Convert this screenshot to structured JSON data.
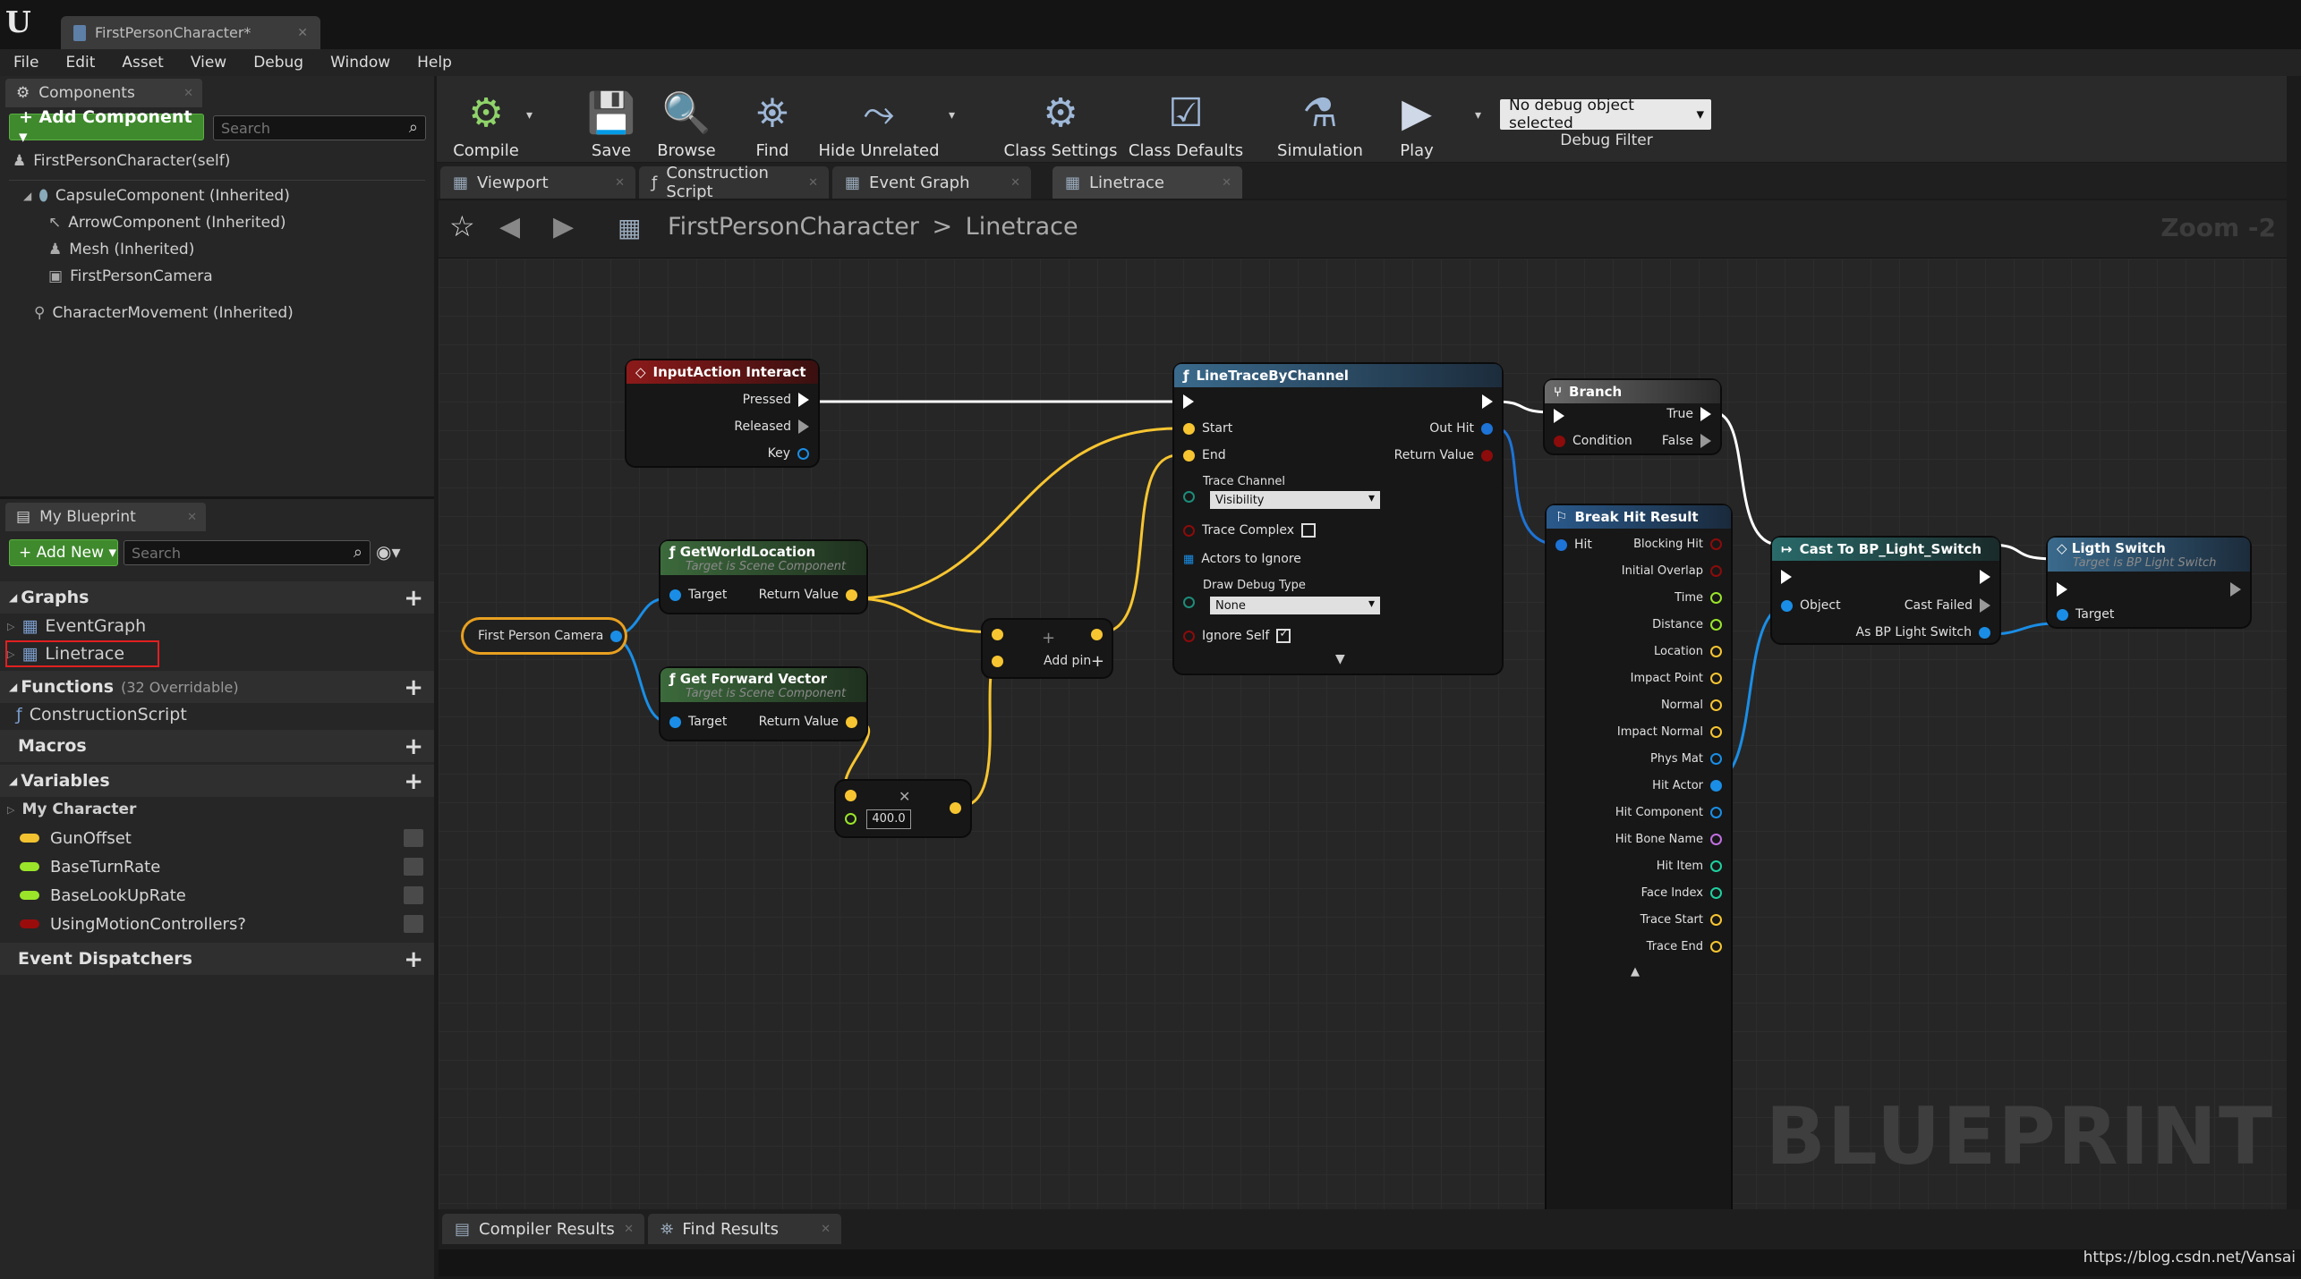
{
  "window": {
    "doc_tab": "FirstPersonCharacter*"
  },
  "menu": [
    "File",
    "Edit",
    "Asset",
    "View",
    "Debug",
    "Window",
    "Help"
  ],
  "components_panel": {
    "tab": "Components",
    "add_button": "+ Add Component ▾",
    "search_placeholder": "Search",
    "self": "FirstPersonCharacter(self)",
    "tree": [
      "CapsuleComponent (Inherited)",
      "ArrowComponent (Inherited)",
      "Mesh (Inherited)",
      "FirstPersonCamera",
      "CharacterMovement (Inherited)"
    ]
  },
  "my_blueprint": {
    "tab": "My Blueprint",
    "add_new": "+ Add New ▾",
    "search_placeholder": "Search",
    "graphs": {
      "header": "Graphs",
      "items": [
        "EventGraph",
        "Linetrace"
      ]
    },
    "functions": {
      "header": "Functions",
      "count": "(32 Overridable)",
      "items": [
        "ConstructionScript"
      ]
    },
    "macros": "Macros",
    "variables": {
      "header": "Variables",
      "category": "My Character",
      "items": [
        {
          "name": "GunOffset",
          "color": "#f2c230"
        },
        {
          "name": "BaseTurnRate",
          "color": "#9ae52a"
        },
        {
          "name": "BaseLookUpRate",
          "color": "#9ae52a"
        },
        {
          "name": "UsingMotionControllers?",
          "color": "#9a0c0c"
        }
      ]
    },
    "event_dispatchers": "Event Dispatchers"
  },
  "toolbar": {
    "compile": "Compile",
    "save": "Save",
    "browse": "Browse",
    "find": "Find",
    "hide_unrelated": "Hide Unrelated",
    "class_settings": "Class Settings",
    "class_defaults": "Class Defaults",
    "simulation": "Simulation",
    "play": "Play",
    "debug_object": "No debug object selected",
    "debug_filter": "Debug Filter"
  },
  "graph_tabs": [
    "Viewport",
    "Construction Script",
    "Event Graph",
    "Linetrace"
  ],
  "breadcrumb": {
    "root": "FirstPersonCharacter",
    "sep": ">",
    "current": "Linetrace",
    "zoom": "Zoom -2"
  },
  "watermark": "BLUEPRINT",
  "nodes": {
    "input_action": {
      "title": "InputAction Interact",
      "pins": [
        "Pressed",
        "Released",
        "Key"
      ]
    },
    "camera": {
      "title": "First Person Camera"
    },
    "get_world_location": {
      "title": "GetWorldLocation",
      "subtitle": "Target is Scene Component",
      "in": "Target",
      "out": "Return Value"
    },
    "get_forward_vector": {
      "title": "Get Forward Vector",
      "subtitle": "Target is Scene Component",
      "in": "Target",
      "out": "Return Value"
    },
    "add": {
      "add_pin": "Add pin"
    },
    "multiply": {
      "value": "400.0"
    },
    "line_trace": {
      "title": "LineTraceByChannel",
      "start": "Start",
      "end": "End",
      "out_hit": "Out Hit",
      "return_value": "Return Value",
      "trace_channel": "Trace Channel",
      "trace_channel_value": "Visibility",
      "trace_complex": "Trace Complex",
      "actors_to_ignore": "Actors to Ignore",
      "draw_debug_type": "Draw Debug Type",
      "draw_debug_value": "None",
      "ignore_self": "Ignore Self"
    },
    "branch": {
      "title": "Branch",
      "condition": "Condition",
      "true": "True",
      "false": "False"
    },
    "break_hit": {
      "title": "Break Hit Result",
      "in": "Hit",
      "outs": [
        "Blocking Hit",
        "Initial Overlap",
        "Time",
        "Distance",
        "Location",
        "Impact Point",
        "Normal",
        "Impact Normal",
        "Phys Mat",
        "Hit Actor",
        "Hit Component",
        "Hit Bone Name",
        "Hit Item",
        "Face Index",
        "Trace Start",
        "Trace End"
      ]
    },
    "cast": {
      "title": "Cast To BP_Light_Switch",
      "object": "Object",
      "cast_failed": "Cast Failed",
      "as_switch": "As BP Light Switch"
    },
    "light_switch": {
      "title": "Ligth Switch",
      "subtitle": "Target is BP Light Switch",
      "target": "Target"
    }
  },
  "bottom_tabs": [
    "Compiler Results",
    "Find Results"
  ],
  "status_url": "https://blog.csdn.net/Vansai",
  "colors": {
    "exec": "#ffffff",
    "vector": "#f7c531",
    "bool": "#8c0b0b",
    "object": "#1a8ee6",
    "float": "#9ae52a",
    "struct": "#1d73d6"
  }
}
